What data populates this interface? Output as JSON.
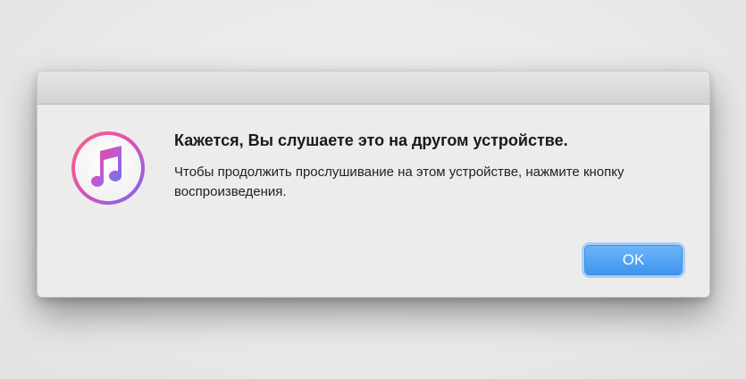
{
  "dialog": {
    "icon": "itunes-music-note-icon",
    "headline": "Кажется, Вы слушаете это на другом устройстве.",
    "message": "Чтобы продолжить прослушивание на этом устройстве, нажмите кнопку воспроизведения.",
    "ok_label": "OK"
  },
  "colors": {
    "accent": "#3f95ee",
    "icon_gradient_start": "#f24b7a",
    "icon_gradient_end": "#7c5cf0"
  }
}
